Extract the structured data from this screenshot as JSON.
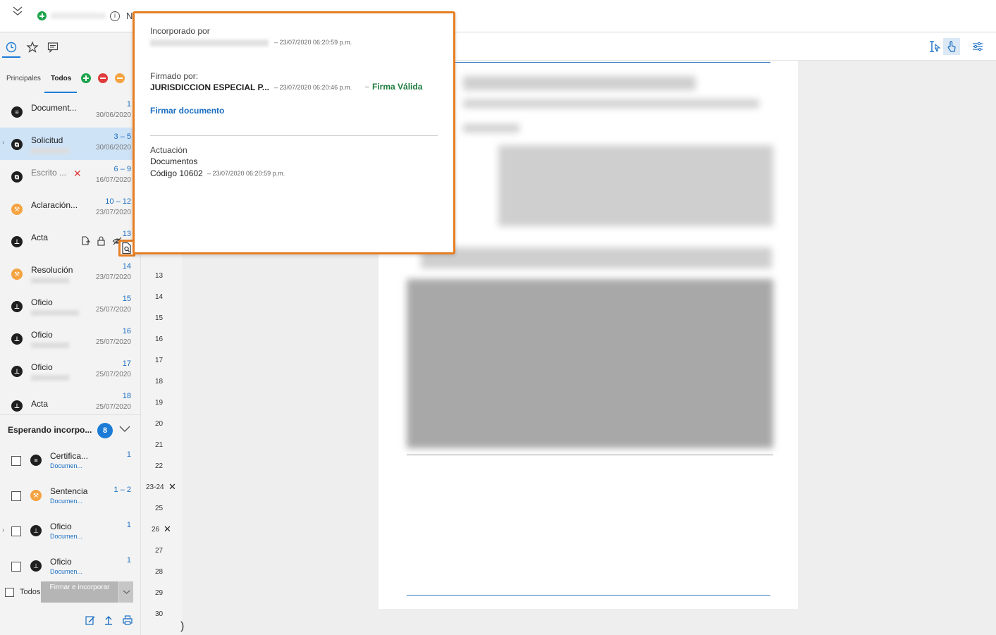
{
  "topbar": {
    "letter": "N"
  },
  "left_tabs": {
    "principales": "Principales",
    "todos": "Todos"
  },
  "documents": [
    {
      "name": "Document...",
      "pages": "1",
      "date": "30/06/2020",
      "icon": "doc"
    },
    {
      "name": "Solicitud",
      "pages": "3 – 5",
      "date": "30/06/2020",
      "icon": "multi"
    },
    {
      "name": "Escrito ...",
      "pages": "6 – 9",
      "date": "16/07/2020",
      "icon": "multi"
    },
    {
      "name": "Aclaración...",
      "pages": "10 – 12",
      "date": "23/07/2020",
      "icon": "gavel"
    },
    {
      "name": "Acta",
      "pages": "13",
      "date": "",
      "icon": "stamp"
    },
    {
      "name": "Resolución",
      "pages": "14",
      "date": "23/07/2020",
      "icon": "gavel"
    },
    {
      "name": "Oficio",
      "pages": "15",
      "date": "25/07/2020",
      "icon": "stamp"
    },
    {
      "name": "Oficio",
      "pages": "16",
      "date": "25/07/2020",
      "icon": "stamp"
    },
    {
      "name": "Oficio",
      "pages": "17",
      "date": "25/07/2020",
      "icon": "stamp"
    },
    {
      "name": "Acta",
      "pages": "18",
      "date": "25/07/2020",
      "icon": "stamp"
    }
  ],
  "waiting": {
    "title": "Esperando incorpo...",
    "count": "8",
    "items": [
      {
        "name": "Certifica...",
        "sub": "Documen...",
        "pages": "1"
      },
      {
        "name": "Sentencia",
        "sub": "Documen...",
        "pages": "1 – 2"
      },
      {
        "name": "Oficio",
        "sub": "Documen...",
        "pages": "1"
      },
      {
        "name": "Oficio",
        "sub": "Documen...",
        "pages": "1"
      }
    ],
    "select_all": "Todos",
    "sign_button": "Firmar e incorporar"
  },
  "page_strip": [
    "13",
    "14",
    "15",
    "16",
    "17",
    "18",
    "19",
    "20",
    "21",
    "22",
    "23-24",
    "25",
    "26",
    "27",
    "28",
    "29",
    "30"
  ],
  "popup": {
    "incorporated_label": "Incorporado por",
    "incorporated_time": "– 23/07/2020 06:20:59 p.m.",
    "signed_label": "Firmado por:",
    "signer": "JURISDICCION ESPECIAL P...",
    "signed_time": "– 23/07/2020 06:20:46 p.m.",
    "valid_sep": "–",
    "valid_text": "Firma Válida",
    "sign_link": "Firmar documento",
    "actuacion_label": "Actuación",
    "actuacion_value": "Documentos",
    "code": "Código 10602",
    "code_time": "– 23/07/2020 06:20:59 p.m."
  },
  "colors": {
    "accent": "#1b7bd6",
    "highlight": "#e67e22",
    "valid": "#1e7d3e",
    "selected": "#cfe3f7"
  }
}
